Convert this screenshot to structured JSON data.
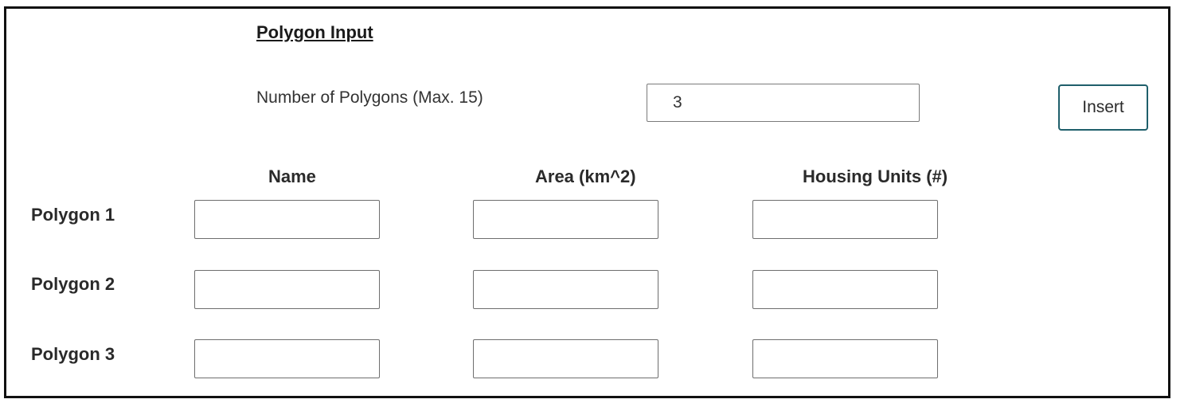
{
  "form": {
    "title": "Polygon Input",
    "count_label": "Number of Polygons (Max. 15)",
    "count_value": "3",
    "insert_label": "Insert"
  },
  "table": {
    "columns": [
      "Name",
      "Area (km^2)",
      "Housing Units (#)"
    ],
    "rows": [
      {
        "label": "Polygon 1",
        "name": "",
        "area": "",
        "housing": ""
      },
      {
        "label": "Polygon 2",
        "name": "",
        "area": "",
        "housing": ""
      },
      {
        "label": "Polygon 3",
        "name": "",
        "area": "",
        "housing": ""
      }
    ]
  },
  "colors": {
    "border": "#111111",
    "button_border": "#1f5f6b",
    "input_border": "#6e6e6e"
  }
}
